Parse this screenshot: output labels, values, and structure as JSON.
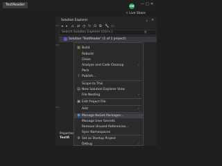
{
  "titlebar": {
    "app_name": "TextReader",
    "avatar_initials": "OM",
    "min": "—",
    "max": "□",
    "close": "✕"
  },
  "live_share": "Live Share",
  "solution_explorer": {
    "title": "Solution Explorer",
    "search_placeholder": "Search Solution Explorer (Ctrl+;)",
    "solution_label": "Solution 'TextReader' (1 of 1 project)",
    "pin": "📌",
    "close": "✕"
  },
  "bottom_panel": {
    "properties": "Properties",
    "title": "TextR"
  },
  "context_menu": {
    "items": [
      {
        "label": "Build",
        "icon": "build-icon"
      },
      {
        "label": "Rebuild",
        "icon": ""
      },
      {
        "label": "Clean",
        "icon": ""
      },
      {
        "label": "Analyze and Code Cleanup",
        "icon": "",
        "arrow": "›"
      },
      {
        "label": "Pack",
        "icon": ""
      },
      {
        "label": "Publish...",
        "icon": "publish-icon"
      },
      {
        "label": "Scope to This",
        "icon": ""
      },
      {
        "label": "New Solution Explorer View",
        "icon": "new-view-icon"
      },
      {
        "label": "File Nesting",
        "icon": "",
        "arrow": "›"
      },
      {
        "label": "Edit Project File",
        "icon": "edit-icon"
      },
      {
        "label": "Add",
        "icon": "",
        "arrow": "›"
      },
      {
        "label": "Manage NuGet Packages...",
        "icon": "nuget-icon",
        "highlight": true
      },
      {
        "label": "Manage User Secrets",
        "icon": ""
      },
      {
        "label": "Remove Unused References...",
        "icon": ""
      },
      {
        "label": "Sync Namespaces",
        "icon": ""
      },
      {
        "label": "Set as Startup Project",
        "icon": "gear-icon"
      },
      {
        "label": "Debug",
        "icon": "",
        "arrow": "›"
      }
    ]
  },
  "colors": {
    "accent": "#0e639c",
    "highlight": "#3f3f46",
    "avatar": "#2e9e5b"
  }
}
